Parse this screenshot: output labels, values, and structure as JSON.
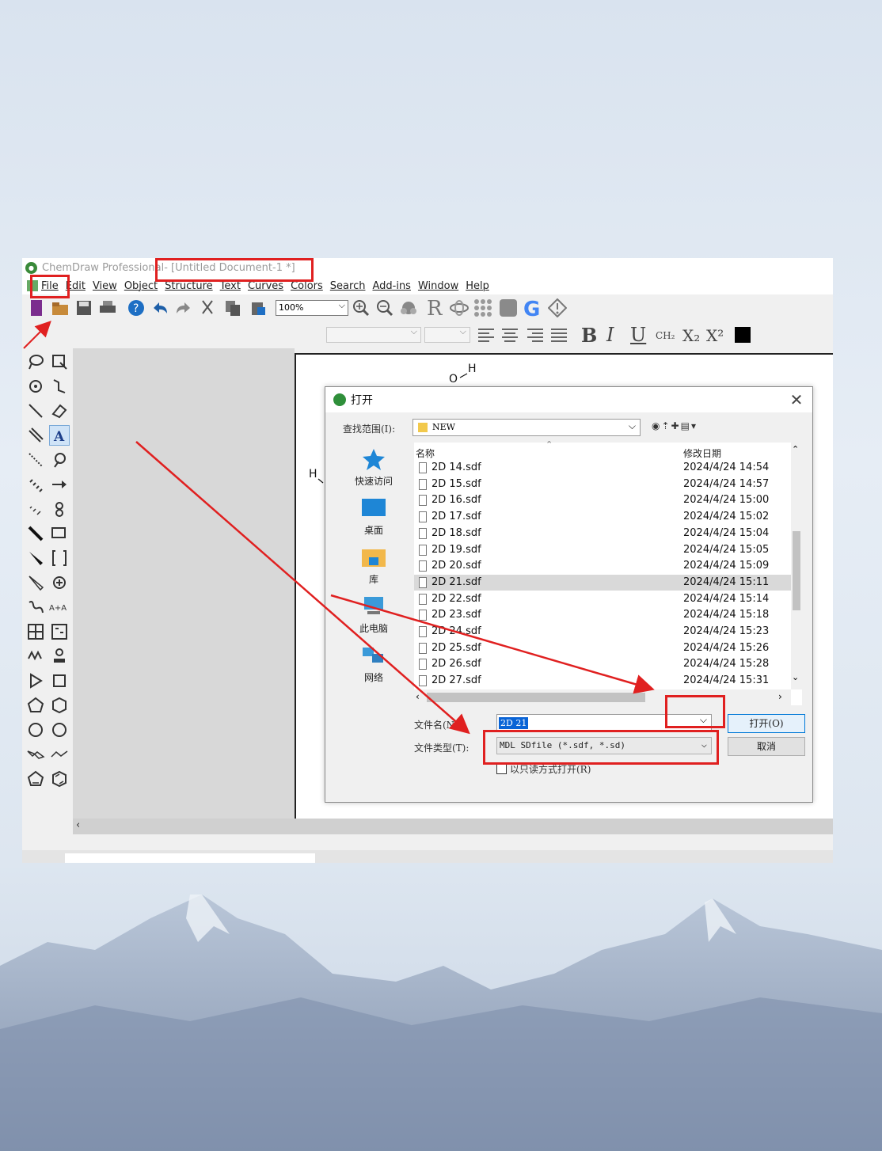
{
  "window": {
    "app_name": "ChemDraw Professional",
    "doc_title": " - [Untitled Document-1 *]"
  },
  "menu": [
    "File",
    "Edit",
    "View",
    "Object",
    "Structure",
    "Text",
    "Curves",
    "Colors",
    "Search",
    "Add-ins",
    "Window",
    "Help"
  ],
  "toolbar": {
    "zoom": "100%",
    "format_labels": {
      "bold": "B",
      "italic": "I",
      "underline": "U",
      "formula": "CH₂",
      "subscript": "X₂",
      "superscript": "X²"
    }
  },
  "canvas": {
    "atom_oh": "O",
    "atom_h_top": "H",
    "atom_h_left": "H"
  },
  "dialog": {
    "title": "打开",
    "close": "✕",
    "look_in_label": "查找范围(I):",
    "look_in_value": "NEW",
    "places": [
      "快速访问",
      "桌面",
      "库",
      "此电脑",
      "网络"
    ],
    "columns": {
      "name": "名称",
      "date": "修改日期"
    },
    "files": [
      {
        "name": "2D 14.sdf",
        "date": "2024/4/24 14:54"
      },
      {
        "name": "2D 15.sdf",
        "date": "2024/4/24 14:57"
      },
      {
        "name": "2D 16.sdf",
        "date": "2024/4/24 15:00"
      },
      {
        "name": "2D 17.sdf",
        "date": "2024/4/24 15:02"
      },
      {
        "name": "2D 18.sdf",
        "date": "2024/4/24 15:04"
      },
      {
        "name": "2D 19.sdf",
        "date": "2024/4/24 15:05"
      },
      {
        "name": "2D 20.sdf",
        "date": "2024/4/24 15:09"
      },
      {
        "name": "2D 21.sdf",
        "date": "2024/4/24 15:11"
      },
      {
        "name": "2D 22.sdf",
        "date": "2024/4/24 15:14"
      },
      {
        "name": "2D 23.sdf",
        "date": "2024/4/24 15:18"
      },
      {
        "name": "2D 24.sdf",
        "date": "2024/4/24 15:23"
      },
      {
        "name": "2D 25.sdf",
        "date": "2024/4/24 15:26"
      },
      {
        "name": "2D 26.sdf",
        "date": "2024/4/24 15:28"
      },
      {
        "name": "2D 27.sdf",
        "date": "2024/4/24 15:31"
      }
    ],
    "selected_index": 7,
    "filename_label": "文件名(N):",
    "filename_value": "2D 21",
    "filetype_label": "文件类型(T):",
    "filetype_value": "MDL SDfile (*.sdf, *.sd)",
    "open_button": "打开(O)",
    "cancel_button": "取消",
    "readonly_label": "以只读方式打开(R)"
  },
  "colors": {
    "annotation_red": "#e02020",
    "selection_blue": "#0a64d6"
  }
}
